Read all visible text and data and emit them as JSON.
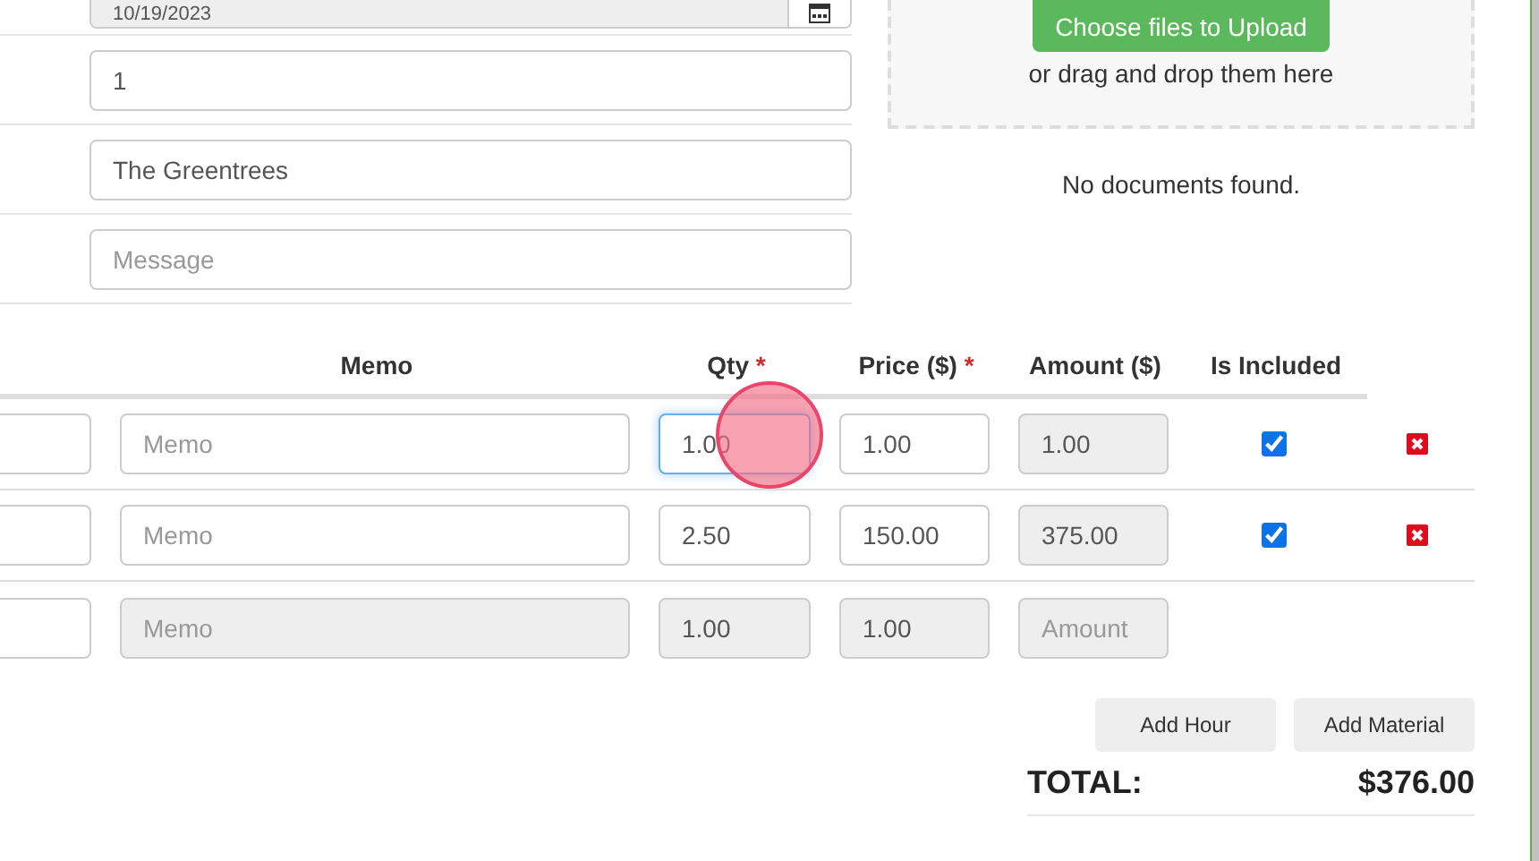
{
  "form_fields": [
    {
      "kind": "date",
      "value": "10/19/2023",
      "disabled": true
    },
    {
      "kind": "text",
      "value": "1",
      "disabled": false
    },
    {
      "kind": "text",
      "value": "The Greentrees",
      "disabled": false
    },
    {
      "kind": "text",
      "placeholder": "Message",
      "disabled": false
    }
  ],
  "upload": {
    "button": "Choose files to Upload",
    "hint": "or drag and drop them here",
    "empty_message": "No documents found."
  },
  "table": {
    "columns": [
      {
        "label": "Memo",
        "required": false
      },
      {
        "label": "Qty",
        "required": true,
        "required_mark": "*"
      },
      {
        "label": "Price ($)",
        "required": true,
        "required_mark": "*"
      },
      {
        "label": "Amount ($)",
        "required": false
      },
      {
        "label": "Is Included",
        "required": false
      }
    ],
    "rows": [
      {
        "kind": "line",
        "memo_placeholder": "Memo",
        "qty": "1.00",
        "price": "1.00",
        "amount": "1.00",
        "included": true,
        "focused": true,
        "disabled": false
      },
      {
        "kind": "line",
        "memo_placeholder": "Memo",
        "qty": "2.50",
        "price": "150.00",
        "amount": "375.00",
        "included": true,
        "focused": false,
        "disabled": false
      },
      {
        "kind": "draft",
        "memo_placeholder": "Memo",
        "qty": "1.00",
        "price": "1.00",
        "amount_placeholder": "Amount",
        "focused": false,
        "disabled": true
      }
    ]
  },
  "buttons": [
    "Add Hour",
    "Add Material"
  ],
  "total": {
    "label": "TOTAL:",
    "value": "$376.00"
  }
}
